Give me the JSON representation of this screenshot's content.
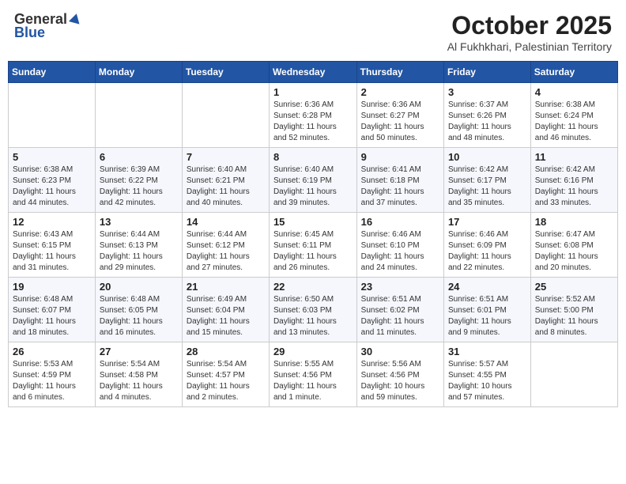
{
  "header": {
    "logo_general": "General",
    "logo_blue": "Blue",
    "month": "October 2025",
    "location": "Al Fukhkhari, Palestinian Territory"
  },
  "days_of_week": [
    "Sunday",
    "Monday",
    "Tuesday",
    "Wednesday",
    "Thursday",
    "Friday",
    "Saturday"
  ],
  "weeks": [
    [
      {
        "day": "",
        "info": ""
      },
      {
        "day": "",
        "info": ""
      },
      {
        "day": "",
        "info": ""
      },
      {
        "day": "1",
        "info": "Sunrise: 6:36 AM\nSunset: 6:28 PM\nDaylight: 11 hours\nand 52 minutes."
      },
      {
        "day": "2",
        "info": "Sunrise: 6:36 AM\nSunset: 6:27 PM\nDaylight: 11 hours\nand 50 minutes."
      },
      {
        "day": "3",
        "info": "Sunrise: 6:37 AM\nSunset: 6:26 PM\nDaylight: 11 hours\nand 48 minutes."
      },
      {
        "day": "4",
        "info": "Sunrise: 6:38 AM\nSunset: 6:24 PM\nDaylight: 11 hours\nand 46 minutes."
      }
    ],
    [
      {
        "day": "5",
        "info": "Sunrise: 6:38 AM\nSunset: 6:23 PM\nDaylight: 11 hours\nand 44 minutes."
      },
      {
        "day": "6",
        "info": "Sunrise: 6:39 AM\nSunset: 6:22 PM\nDaylight: 11 hours\nand 42 minutes."
      },
      {
        "day": "7",
        "info": "Sunrise: 6:40 AM\nSunset: 6:21 PM\nDaylight: 11 hours\nand 40 minutes."
      },
      {
        "day": "8",
        "info": "Sunrise: 6:40 AM\nSunset: 6:19 PM\nDaylight: 11 hours\nand 39 minutes."
      },
      {
        "day": "9",
        "info": "Sunrise: 6:41 AM\nSunset: 6:18 PM\nDaylight: 11 hours\nand 37 minutes."
      },
      {
        "day": "10",
        "info": "Sunrise: 6:42 AM\nSunset: 6:17 PM\nDaylight: 11 hours\nand 35 minutes."
      },
      {
        "day": "11",
        "info": "Sunrise: 6:42 AM\nSunset: 6:16 PM\nDaylight: 11 hours\nand 33 minutes."
      }
    ],
    [
      {
        "day": "12",
        "info": "Sunrise: 6:43 AM\nSunset: 6:15 PM\nDaylight: 11 hours\nand 31 minutes."
      },
      {
        "day": "13",
        "info": "Sunrise: 6:44 AM\nSunset: 6:13 PM\nDaylight: 11 hours\nand 29 minutes."
      },
      {
        "day": "14",
        "info": "Sunrise: 6:44 AM\nSunset: 6:12 PM\nDaylight: 11 hours\nand 27 minutes."
      },
      {
        "day": "15",
        "info": "Sunrise: 6:45 AM\nSunset: 6:11 PM\nDaylight: 11 hours\nand 26 minutes."
      },
      {
        "day": "16",
        "info": "Sunrise: 6:46 AM\nSunset: 6:10 PM\nDaylight: 11 hours\nand 24 minutes."
      },
      {
        "day": "17",
        "info": "Sunrise: 6:46 AM\nSunset: 6:09 PM\nDaylight: 11 hours\nand 22 minutes."
      },
      {
        "day": "18",
        "info": "Sunrise: 6:47 AM\nSunset: 6:08 PM\nDaylight: 11 hours\nand 20 minutes."
      }
    ],
    [
      {
        "day": "19",
        "info": "Sunrise: 6:48 AM\nSunset: 6:07 PM\nDaylight: 11 hours\nand 18 minutes."
      },
      {
        "day": "20",
        "info": "Sunrise: 6:48 AM\nSunset: 6:05 PM\nDaylight: 11 hours\nand 16 minutes."
      },
      {
        "day": "21",
        "info": "Sunrise: 6:49 AM\nSunset: 6:04 PM\nDaylight: 11 hours\nand 15 minutes."
      },
      {
        "day": "22",
        "info": "Sunrise: 6:50 AM\nSunset: 6:03 PM\nDaylight: 11 hours\nand 13 minutes."
      },
      {
        "day": "23",
        "info": "Sunrise: 6:51 AM\nSunset: 6:02 PM\nDaylight: 11 hours\nand 11 minutes."
      },
      {
        "day": "24",
        "info": "Sunrise: 6:51 AM\nSunset: 6:01 PM\nDaylight: 11 hours\nand 9 minutes."
      },
      {
        "day": "25",
        "info": "Sunrise: 5:52 AM\nSunset: 5:00 PM\nDaylight: 11 hours\nand 8 minutes."
      }
    ],
    [
      {
        "day": "26",
        "info": "Sunrise: 5:53 AM\nSunset: 4:59 PM\nDaylight: 11 hours\nand 6 minutes."
      },
      {
        "day": "27",
        "info": "Sunrise: 5:54 AM\nSunset: 4:58 PM\nDaylight: 11 hours\nand 4 minutes."
      },
      {
        "day": "28",
        "info": "Sunrise: 5:54 AM\nSunset: 4:57 PM\nDaylight: 11 hours\nand 2 minutes."
      },
      {
        "day": "29",
        "info": "Sunrise: 5:55 AM\nSunset: 4:56 PM\nDaylight: 11 hours\nand 1 minute."
      },
      {
        "day": "30",
        "info": "Sunrise: 5:56 AM\nSunset: 4:56 PM\nDaylight: 10 hours\nand 59 minutes."
      },
      {
        "day": "31",
        "info": "Sunrise: 5:57 AM\nSunset: 4:55 PM\nDaylight: 10 hours\nand 57 minutes."
      },
      {
        "day": "",
        "info": ""
      }
    ]
  ]
}
